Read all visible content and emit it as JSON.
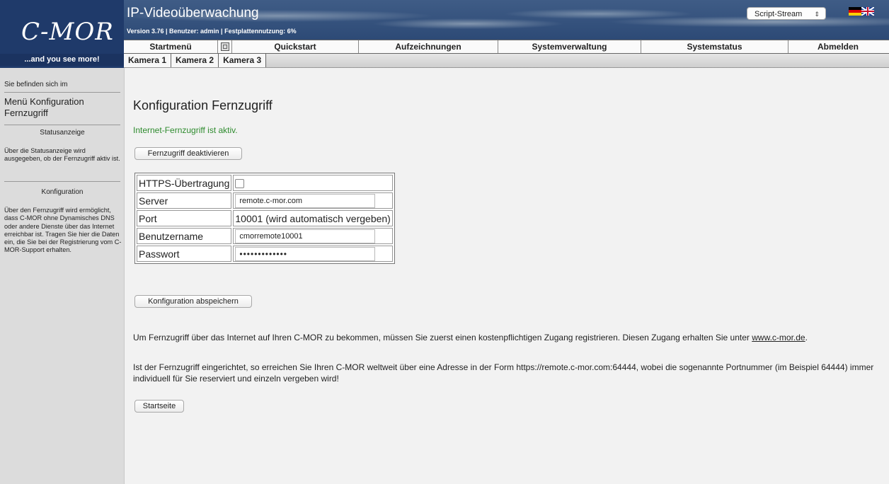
{
  "header": {
    "logo": "C-MOR",
    "tagline": "...and you see more!",
    "title": "IP-Videoüberwachung",
    "version_line": "Version 3.76 | Benutzer: admin | Festplattennutzung: 6%",
    "stream_select": "Script-Stream",
    "languages": [
      "de-flag-icon",
      "uk-flag-icon"
    ]
  },
  "main_nav": {
    "items": [
      "Startmenü",
      "Quickstart",
      "Aufzeichnungen",
      "Systemverwaltung",
      "Systemstatus",
      "Abmelden"
    ],
    "fullscreen_icon": "fullscreen-icon"
  },
  "camera_nav": {
    "tabs": [
      "Kamera 1",
      "Kamera 2",
      "Kamera 3"
    ]
  },
  "sidebar": {
    "where_label": "Sie befinden sich im",
    "menu_title": "Menü Konfiguration Fernzugriff",
    "section1_title": "Statusanzeige",
    "section1_text": "Über die Statusanzeige wird ausgegeben, ob der Fernzugriff aktiv ist.",
    "section2_title": "Konfiguration",
    "section2_text": "Über den Fernzugriff wird ermöglicht, dass C-MOR ohne Dynamisches DNS oder andere Dienste über das Internet erreichbar ist. Tragen Sie hier die Daten ein, die Sie bei der Registrierung vom C-MOR-Support erhalten."
  },
  "content": {
    "page_title": "Konfiguration Fernzugriff",
    "status_message": "Internet-Fernzugriff ist aktiv.",
    "deactivate_button": "Fernzugriff deaktivieren",
    "form": {
      "https_label": "HTTPS-Übertragung",
      "https_checked": false,
      "server_label": "Server",
      "server_value": "remote.c-mor.com",
      "port_label": "Port",
      "port_value": "10001 (wird automatisch vergeben)",
      "username_label": "Benutzername",
      "username_value": "cmorremote10001",
      "password_label": "Passwort",
      "password_value": "•••••••••••••"
    },
    "save_button": "Konfiguration abspeichern",
    "info_1_text": "Um Fernzugriff über das Internet auf Ihren C-MOR zu bekommen, müssen Sie zuerst einen kostenpflichtigen Zugang registrieren. Diesen Zugang erhalten Sie unter ",
    "info_1_link": "www.c-mor.de",
    "info_1_end": ".",
    "info_2_text": "Ist der Fernzugriff eingerichtet, so erreichen Sie Ihren C-MOR weltweit über eine Adresse in der Form https://remote.c-mor.com:64444, wobei die sogenannte Portnummer (im Beispiel 64444) immer individuell für Sie reserviert und einzeln vergeben wird!",
    "home_button": "Startseite"
  },
  "colors": {
    "header_blue": "#2d4a76",
    "status_green": "#2e8b2e",
    "sidebar_bg": "#dcdcdc"
  }
}
